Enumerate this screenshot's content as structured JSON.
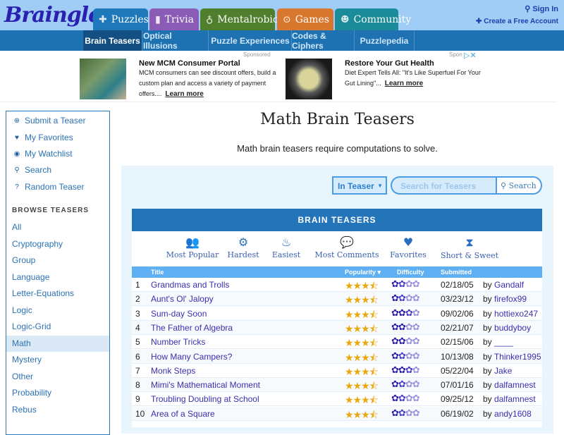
{
  "header": {
    "logo": "Braingle",
    "tabs": [
      {
        "label": "Puzzles",
        "icon": "puzzle-icon",
        "color": "#1e78ba"
      },
      {
        "label": "Trivia",
        "icon": "book-icon",
        "color": "#8b5cb6"
      },
      {
        "label": "Mentalrobics",
        "icon": "lightbulb-icon",
        "color": "#4f7e2c"
      },
      {
        "label": "Games",
        "icon": "gamepad-icon",
        "color": "#d8782f"
      },
      {
        "label": "Community",
        "icon": "people-icon",
        "color": "#1b8b99"
      }
    ],
    "sign_in": "Sign In",
    "create_account": "Create a Free Account"
  },
  "subnav": [
    "Brain Teasers",
    "Optical Illusions",
    "Puzzle Experiences",
    "Codes & Ciphers",
    "Puzzlepedia"
  ],
  "ads": {
    "sponsored": "Sponsored",
    "sponsored2": "Spon",
    "items": [
      {
        "title": "New MCM Consumer Portal",
        "body": "MCM consumers can see discount offers, build a custom plan and access a variety of payment offers....",
        "cta": "Learn more"
      },
      {
        "title": "Restore Your Gut Health",
        "body": "Diet Expert Tells All: \"It's Like Superfuel For Your Gut Lining\"...",
        "cta": "Learn more"
      }
    ]
  },
  "sidebar": {
    "actions": [
      {
        "label": "Submit a Teaser",
        "icon": "plus-circle-icon"
      },
      {
        "label": "My Favorites",
        "icon": "heart-icon"
      },
      {
        "label": "My Watchlist",
        "icon": "eye-icon"
      },
      {
        "label": "Search",
        "icon": "search-icon"
      },
      {
        "label": "Random Teaser",
        "icon": "question-icon"
      }
    ],
    "browse_heading": "BROWSE TEASERS",
    "categories": [
      "All",
      "Cryptography",
      "Group",
      "Language",
      "Letter-Equations",
      "Logic",
      "Logic-Grid",
      "Math",
      "Mystery",
      "Other",
      "Probability",
      "Rebus"
    ],
    "active": "Math"
  },
  "main": {
    "title": "Math Brain Teasers",
    "description": "Math brain teasers require computations to solve.",
    "search": {
      "scope": "In Teaser",
      "placeholder": "Search for Teasers",
      "button": "Search"
    },
    "table": {
      "heading": "BRAIN TEASERS",
      "filters": [
        {
          "label": "Most Popular",
          "icon": "users-icon"
        },
        {
          "label": "Hardest",
          "icon": "gears-icon"
        },
        {
          "label": "Easiest",
          "icon": "cake-icon"
        },
        {
          "label": "Most Comments",
          "icon": "comments-icon"
        },
        {
          "label": "Favorites",
          "icon": "heart-icon"
        },
        {
          "label": "Short & Sweet",
          "icon": "hourglass-icon"
        }
      ],
      "columns": {
        "title": "Title",
        "popularity": "Popularity ▾",
        "difficulty": "Difficulty",
        "submitted": "Submitted"
      },
      "rows": [
        {
          "n": "1",
          "title": "Grandmas and Trolls",
          "popularity": 3.5,
          "difficulty": 1.5,
          "date": "02/18/05",
          "by": "by",
          "author": "Gandalf"
        },
        {
          "n": "2",
          "title": "Aunt's Ol' Jalopy",
          "popularity": 3.5,
          "difficulty": 1.5,
          "date": "03/23/12",
          "by": "by",
          "author": "firefox99"
        },
        {
          "n": "3",
          "title": "Sum-day Soon",
          "popularity": 3.5,
          "difficulty": 2.5,
          "date": "09/02/06",
          "by": "by",
          "author": "hottiexo247"
        },
        {
          "n": "4",
          "title": "The Father of Algebra",
          "popularity": 3.5,
          "difficulty": 2,
          "date": "02/21/07",
          "by": "by",
          "author": "buddyboy"
        },
        {
          "n": "5",
          "title": "Number Tricks",
          "popularity": 3.5,
          "difficulty": 2,
          "date": "02/15/06",
          "by": "by",
          "author": "____"
        },
        {
          "n": "6",
          "title": "How Many Campers?",
          "popularity": 3.5,
          "difficulty": 1.5,
          "date": "10/13/08",
          "by": "by",
          "author": "Thinker1995"
        },
        {
          "n": "7",
          "title": "Monk Steps",
          "popularity": 3.5,
          "difficulty": 2.5,
          "date": "05/22/04",
          "by": "by",
          "author": "Jake"
        },
        {
          "n": "8",
          "title": "Mimi's Mathematical Moment",
          "popularity": 3.5,
          "difficulty": 1.5,
          "date": "07/01/16",
          "by": "by",
          "author": "dalfamnest"
        },
        {
          "n": "9",
          "title": "Troubling Doubling at School",
          "popularity": 3.5,
          "difficulty": 1.5,
          "date": "09/25/12",
          "by": "by",
          "author": "dalfamnest"
        },
        {
          "n": "10",
          "title": "Area of a Square",
          "popularity": 3.5,
          "difficulty": 1.5,
          "date": "06/19/02",
          "by": "by",
          "author": "andy1608"
        }
      ]
    }
  }
}
